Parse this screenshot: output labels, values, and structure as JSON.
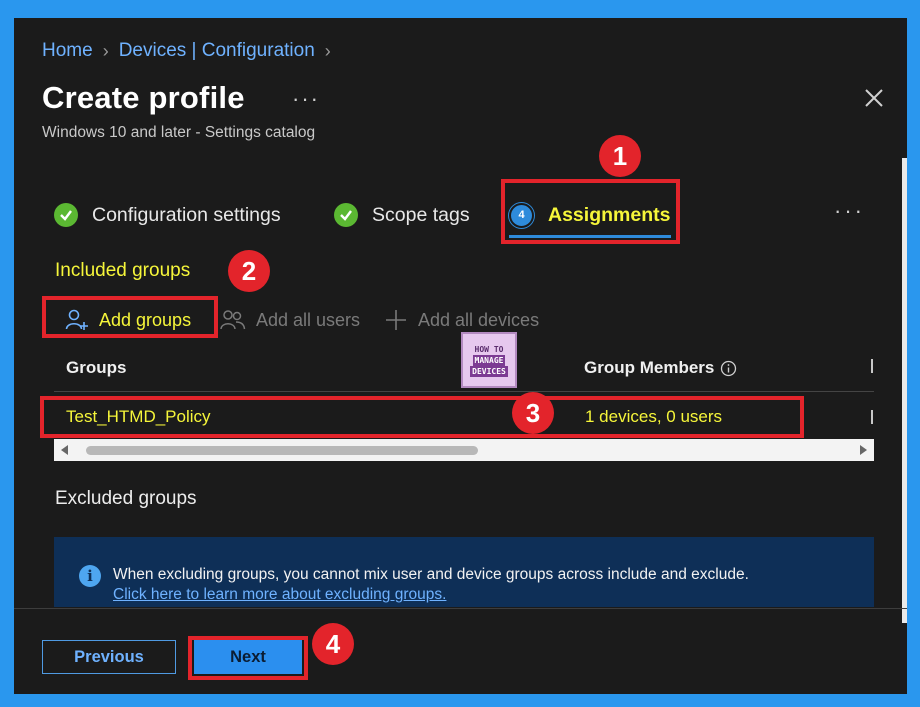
{
  "breadcrumb": {
    "home": "Home",
    "devices_config": "Devices | Configuration"
  },
  "header": {
    "title": "Create profile",
    "more": "···",
    "subtitle": "Windows 10 and later - Settings catalog"
  },
  "steps": [
    {
      "label": "Configuration settings",
      "state": "done"
    },
    {
      "label": "Scope tags",
      "state": "done"
    },
    {
      "label": "Assignments",
      "number": "4",
      "state": "current"
    }
  ],
  "steps_more": "···",
  "included": {
    "title": "Included groups",
    "add_groups": "Add groups",
    "add_all_users": "Add all users",
    "add_all_devices": "Add all devices"
  },
  "logo": {
    "line1": "HOW TO",
    "line2": "MANAGE",
    "line3": "DEVICES"
  },
  "table": {
    "col_groups": "Groups",
    "col_members": "Group Members",
    "rows": [
      {
        "group": "Test_HTMD_Policy",
        "members": "1 devices, 0 users"
      }
    ]
  },
  "excluded": {
    "title": "Excluded groups",
    "info_text": "When excluding groups, you cannot mix user and device groups across include and exclude.",
    "info_link": "Click here to learn more about excluding groups."
  },
  "footer": {
    "previous": "Previous",
    "next": "Next"
  },
  "callouts": [
    "1",
    "2",
    "3",
    "4"
  ],
  "colors": {
    "highlight": "#f6f63a",
    "annotation": "#e3242b",
    "accent": "#2b8fef",
    "check": "#5bb832"
  }
}
